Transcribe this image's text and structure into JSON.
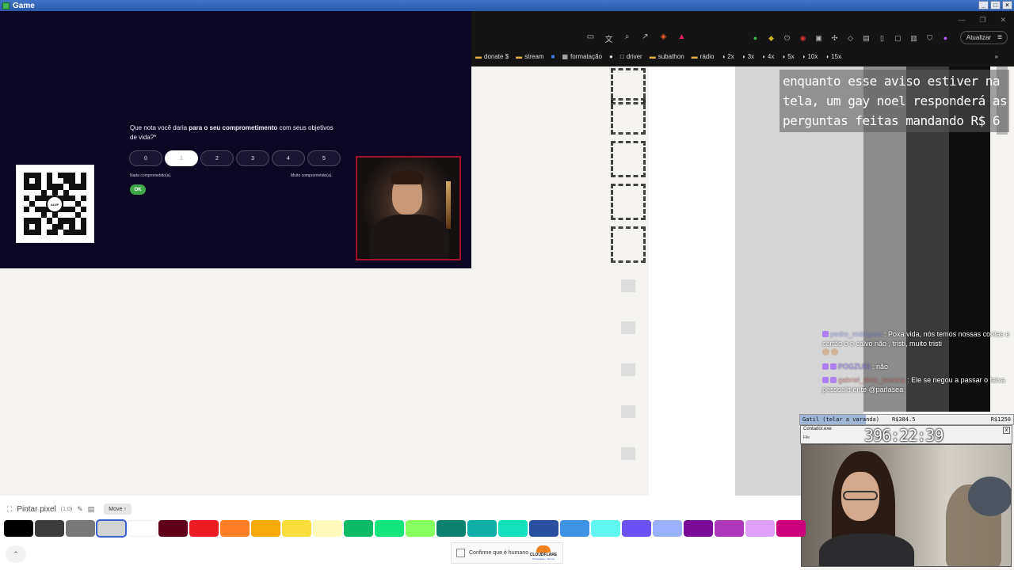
{
  "window": {
    "title": "Game"
  },
  "survey": {
    "question_plain_1": "Que nota você daria ",
    "question_bold_1": "para o seu comprometimento",
    "question_plain_2": " com seus objetivos de vida?*",
    "options": [
      "0",
      "1",
      "2",
      "3",
      "4",
      "5"
    ],
    "selected_index": 1,
    "scale_low": "Nada comprometido(a).",
    "scale_high": "Muito comprometido(a).",
    "ok_label": "OK"
  },
  "qr_logo_text": "ALVP",
  "browser": {
    "update_label": "Atualizar",
    "menu_icon": "≡",
    "bookmarks": [
      {
        "label": "donate $",
        "icon": "folder-icon"
      },
      {
        "label": "stream",
        "icon": "folder-icon"
      },
      {
        "label": "",
        "icon": "blue-square-icon"
      },
      {
        "label": "formatação",
        "icon": "grid-icon"
      },
      {
        "label": "",
        "icon": "github-icon"
      },
      {
        "label": "driver",
        "icon": "page-icon"
      },
      {
        "label": "subathon",
        "icon": "folder-icon"
      },
      {
        "label": "rádio",
        "icon": "folder-icon"
      },
      {
        "label": "2x",
        "icon": "speed-icon"
      },
      {
        "label": "3x",
        "icon": "speed-icon"
      },
      {
        "label": "4x",
        "icon": "speed-icon"
      },
      {
        "label": "5x",
        "icon": "speed-icon"
      },
      {
        "label": "10x",
        "icon": "speed-icon"
      },
      {
        "label": "15x",
        "icon": "speed-icon"
      }
    ],
    "more_icon": "»"
  },
  "notice": {
    "line1": "enquanto esse aviso estiver na",
    "line2": "tela, um gay noel responderá as",
    "line3": "perguntas feitas mandando R$ 6"
  },
  "chat": [
    {
      "user": "pedro_rodrigues",
      "text": " : Poxa vida, nós temos nossas contas e cartão e o calvo não , tristi, muito tristi"
    },
    {
      "user": "POGZUKI",
      "text": " : não"
    },
    {
      "user": "gabriel_diniz_teixeira",
      "text": " : Ele se negou a passar o faixa pessoalmente @parlasea"
    }
  ],
  "goal": {
    "title": "Gatil (telar a varanda)",
    "current": "R$384.5",
    "target": "R$1250",
    "progress_fraction": 0.3076
  },
  "timer": {
    "window_title": "Contador.exe",
    "file_menu": "File",
    "value": "396:22:39",
    "close": "x"
  },
  "palette": {
    "tool_label": "Pintar pixel",
    "tool_sub": "(1:0)",
    "move_label": "Move ↑",
    "expand_icon": "⌃",
    "selected_index": 3,
    "colors": [
      "#000000",
      "#3c3c3c",
      "#787878",
      "#d2d2d2",
      "#ffffff",
      "#600018",
      "#ed1c24",
      "#ff7f27",
      "#f6aa09",
      "#f9dd3b",
      "#fffabc",
      "#0eb968",
      "#13e67b",
      "#87ff5e",
      "#0c816e",
      "#10aea6",
      "#13e1be",
      "#28509e",
      "#4093e4",
      "#60f7f2",
      "#6b50f6",
      "#99b1fb",
      "#780c99",
      "#aa38b9",
      "#e09ff9",
      "#cb007a"
    ]
  },
  "captcha": {
    "label": "Confirme que é humano",
    "brand": "CLOUDFLARE",
    "links": "Privacidade • Termos"
  }
}
